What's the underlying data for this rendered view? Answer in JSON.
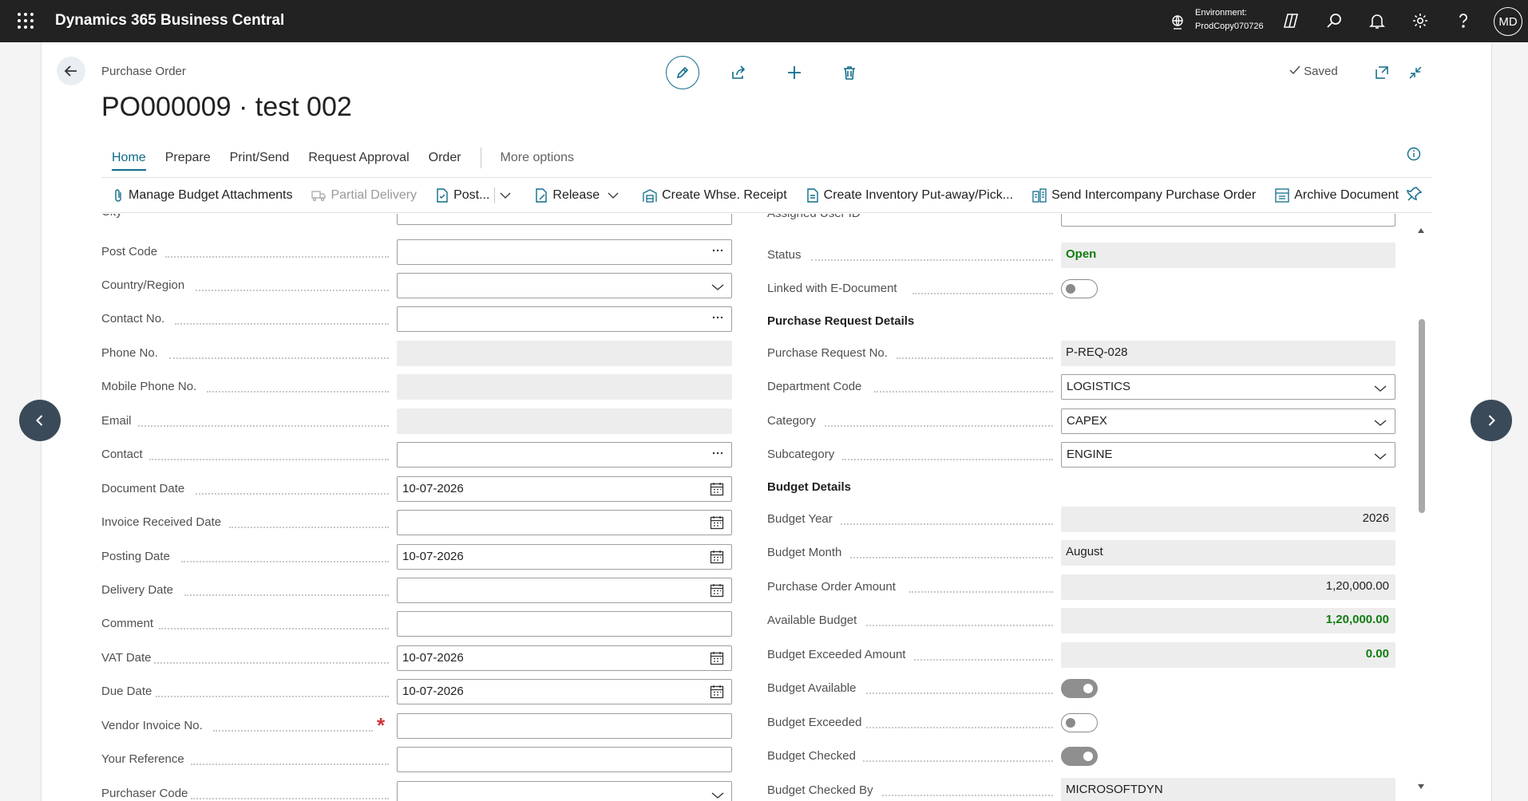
{
  "topbar": {
    "app_name": "Dynamics 365 Business Central",
    "environment_label": "Environment:",
    "environment_value": "ProdCopy070726",
    "user_initials": "MD"
  },
  "header": {
    "breadcrumb": "Purchase Order",
    "title": "PO000009 · test 002",
    "saved_label": "Saved"
  },
  "tabs": [
    "Home",
    "Prepare",
    "Print/Send",
    "Request Approval",
    "Order"
  ],
  "more_options": "More options",
  "actions": {
    "manage_budget": "Manage Budget Attachments",
    "partial_delivery": "Partial Delivery",
    "post": "Post...",
    "release": "Release",
    "create_whse_receipt": "Create Whse. Receipt",
    "create_inventory": "Create Inventory Put-away/Pick...",
    "send_intercompany": "Send Intercompany Purchase Order",
    "archive": "Archive Document"
  },
  "left": {
    "city": "City",
    "post_code": {
      "label": "Post Code",
      "value": ""
    },
    "country": {
      "label": "Country/Region",
      "value": ""
    },
    "contact_no": {
      "label": "Contact No.",
      "value": ""
    },
    "phone": {
      "label": "Phone No.",
      "value": ""
    },
    "mobile": {
      "label": "Mobile Phone No.",
      "value": ""
    },
    "email": {
      "label": "Email",
      "value": ""
    },
    "contact": {
      "label": "Contact",
      "value": ""
    },
    "document_date": {
      "label": "Document Date",
      "value": "10-07-2026"
    },
    "invoice_received_date": {
      "label": "Invoice Received Date",
      "value": ""
    },
    "posting_date": {
      "label": "Posting Date",
      "value": "10-07-2026"
    },
    "delivery_date": {
      "label": "Delivery Date",
      "value": ""
    },
    "comment": {
      "label": "Comment",
      "value": ""
    },
    "vat_date": {
      "label": "VAT Date",
      "value": "10-07-2026"
    },
    "due_date": {
      "label": "Due Date",
      "value": "10-07-2026"
    },
    "vendor_invoice_no": {
      "label": "Vendor Invoice No.",
      "value": ""
    },
    "your_reference": {
      "label": "Your Reference",
      "value": ""
    },
    "purchaser_code": {
      "label": "Purchaser Code",
      "value": ""
    }
  },
  "right": {
    "assigned_user": "Assigned User ID",
    "status": {
      "label": "Status",
      "value": "Open"
    },
    "linked_edoc": {
      "label": "Linked with E-Document",
      "on": false
    },
    "purchase_request_section": "Purchase Request Details",
    "purchase_request_no": {
      "label": "Purchase Request No.",
      "value": "P-REQ-028"
    },
    "department_code": {
      "label": "Department Code",
      "value": "LOGISTICS"
    },
    "category": {
      "label": "Category",
      "value": "CAPEX"
    },
    "subcategory": {
      "label": "Subcategory",
      "value": "ENGINE"
    },
    "budget_section": "Budget Details",
    "budget_year": {
      "label": "Budget Year",
      "value": "2026"
    },
    "budget_month": {
      "label": "Budget Month",
      "value": "August"
    },
    "po_amount": {
      "label": "Purchase Order Amount",
      "value": "1,20,000.00"
    },
    "available_budget": {
      "label": "Available Budget",
      "value": "1,20,000.00"
    },
    "budget_exceeded_amount": {
      "label": "Budget Exceeded Amount",
      "value": "0.00"
    },
    "budget_available": {
      "label": "Budget Available",
      "on": true
    },
    "budget_exceeded": {
      "label": "Budget Exceeded",
      "on": false
    },
    "budget_checked": {
      "label": "Budget Checked",
      "on": true
    },
    "budget_checked_by": {
      "label": "Budget Checked By",
      "value": "MICROSOFTDYN"
    }
  },
  "colors": {
    "accent": "#0f6c8a",
    "topbar": "#222222",
    "positive": "#107c10",
    "required": "#d13438"
  }
}
